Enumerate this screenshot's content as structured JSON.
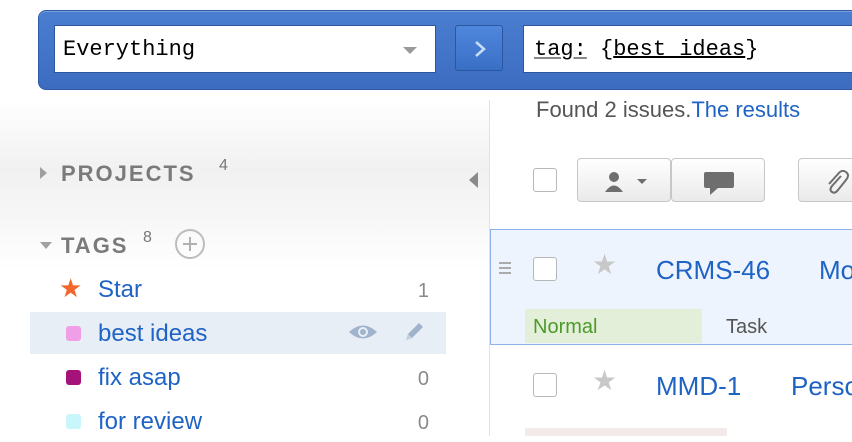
{
  "search": {
    "context_value": "Everything",
    "query_keyword": "tag:",
    "query_open": " {",
    "query_tag": "best ideas",
    "query_close": "}"
  },
  "found": {
    "text": "Found 2 issues.",
    "link": "The results"
  },
  "sidebar": {
    "projects": {
      "title": "PROJECTS",
      "count": "4"
    },
    "tags": {
      "title": "TAGS",
      "count": "8",
      "items": [
        {
          "label": "Star",
          "count": "1",
          "icon": "star-icon",
          "color": "#f2662c"
        },
        {
          "label": "best ideas",
          "count": "",
          "icon": "swatch",
          "color": "#f09ee6"
        },
        {
          "label": "fix asap",
          "count": "0",
          "icon": "swatch",
          "color": "#a5137a"
        },
        {
          "label": "for review",
          "count": "0",
          "icon": "swatch",
          "color": "#c9f6fb"
        }
      ]
    }
  },
  "issues": [
    {
      "id": "CRMS-46",
      "summary": "Mo",
      "priority": "Normal",
      "type": "Task"
    },
    {
      "id": "MMD-1",
      "summary": "Perso",
      "priority": "",
      "type": ""
    }
  ],
  "colors": {
    "accent": "#1f63c4",
    "searchbar": "#4a7ed0",
    "selected_row": "#eef4fd",
    "priority_normal": "#4d9a2a"
  }
}
